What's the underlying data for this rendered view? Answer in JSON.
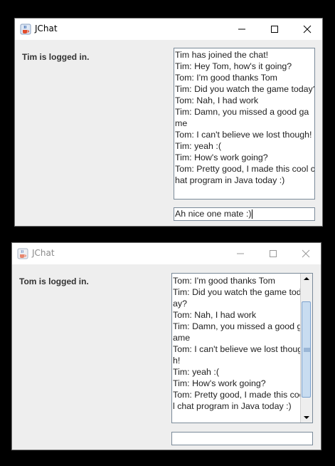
{
  "windows": [
    {
      "title": "JChat",
      "status": "Tim is logged in.",
      "chat_lines": [
        "Tim has joined the chat!",
        "Tim: Hey Tom, how's it going?",
        "Tom: I'm good thanks Tom",
        "Tim: Did you watch the game today?",
        "Tom: Nah, I had work",
        "Tim: Damn, you missed a good ga",
        "me",
        "Tom: I can't believe we lost though!",
        "Tim: yeah :(",
        "Tim: How's work going?",
        "Tom: Pretty good, I made this cool c",
        "hat program in Java today :)"
      ],
      "input_value": "Ah nice one mate :)"
    },
    {
      "title": "JChat",
      "status": "Tom is logged in.",
      "chat_lines": [
        "Tom: I'm good thanks Tom",
        "Tim: Did you watch the game tod",
        "ay?",
        "Tom: Nah, I had work",
        "Tim: Damn, you missed a good g",
        "ame",
        "Tom: I can't believe we lost thoug",
        "h!",
        "Tim: yeah :(",
        "Tim: How's work going?",
        "Tom: Pretty good, I made this coo",
        "l chat program in Java today :)"
      ],
      "input_value": "",
      "scroll_position": 0.55
    }
  ],
  "icons": {
    "app": "java-cup-icon",
    "minimize": "minimize-icon",
    "maximize": "maximize-icon",
    "close": "close-icon",
    "scroll_up": "arrow-up-icon",
    "scroll_down": "arrow-down-icon"
  }
}
